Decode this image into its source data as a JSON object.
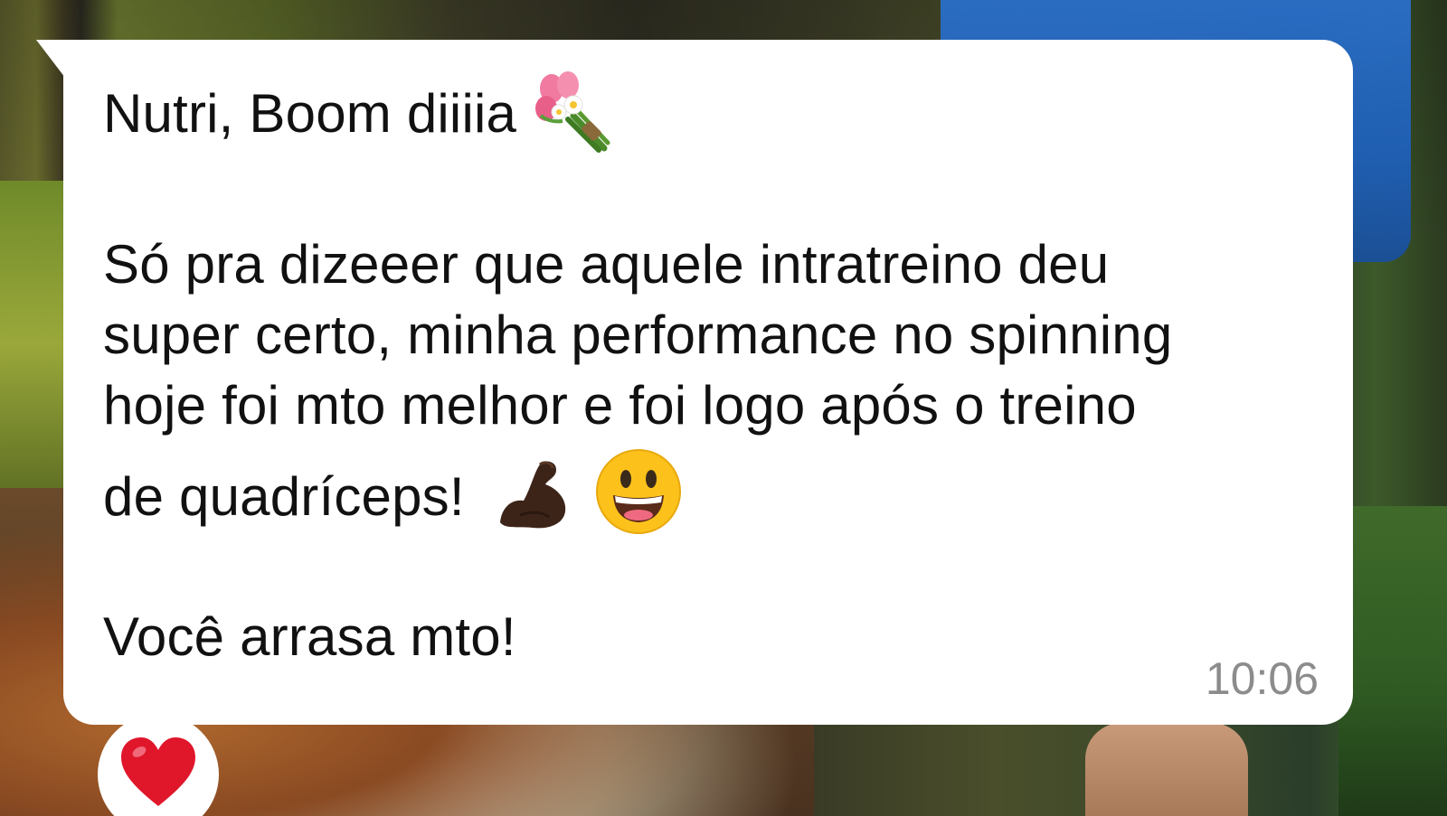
{
  "message": {
    "line_1": "Nutri, Boom diiiia",
    "line_1_emoji": "bouquet-emoji",
    "line_2": "Só pra dizeeer que aquele intratreino deu",
    "line_3": "super certo, minha performance no spinning",
    "line_4": "hoje foi mto melhor e foi logo após o treino",
    "line_5": "de quadríceps!",
    "line_5_emojis": [
      "flexed-biceps-emoji",
      "grinning-face-emoji"
    ],
    "line_6": "Você arrasa mto!",
    "timestamp": "10:06"
  },
  "reaction": {
    "icon": "red-heart-emoji"
  },
  "colors": {
    "bubble": "#ffffff",
    "text": "#111111",
    "timestamp": "#8c8c8c",
    "heart": "#e0162b"
  }
}
